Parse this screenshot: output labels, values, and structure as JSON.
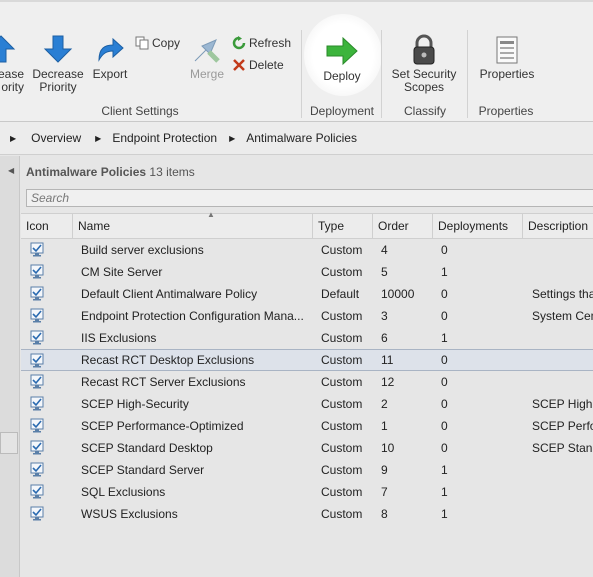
{
  "ribbon": {
    "decrease_priority_partial": [
      "ease",
      "ority"
    ],
    "decrease_priority": [
      "Decrease",
      "Priority"
    ],
    "export": "Export",
    "copy": "Copy",
    "merge": "Merge",
    "refresh": "Refresh",
    "delete": "Delete",
    "deploy": "Deploy",
    "set_security_scopes": [
      "Set Security",
      "Scopes"
    ],
    "properties": "Properties",
    "groups": {
      "client_settings": "Client Settings",
      "deployment": "Deployment",
      "classify": "Classify",
      "properties": "Properties"
    }
  },
  "breadcrumb": [
    "Overview",
    "Endpoint Protection",
    "Antimalware Policies"
  ],
  "list": {
    "title": "Antimalware Policies",
    "count": "13 items",
    "search_placeholder": "Search",
    "columns": [
      "Icon",
      "Name",
      "Type",
      "Order",
      "Deployments",
      "Description"
    ],
    "rows": [
      {
        "name": "Build server exclusions",
        "type": "Custom",
        "order": "4",
        "deployments": "0",
        "description": ""
      },
      {
        "name": "CM Site Server",
        "type": "Custom",
        "order": "5",
        "deployments": "1",
        "description": ""
      },
      {
        "name": "Default Client Antimalware Policy",
        "type": "Default",
        "order": "10000",
        "deployments": "0",
        "description": "Settings tha"
      },
      {
        "name": "Endpoint Protection Configuration Mana...",
        "type": "Custom",
        "order": "3",
        "deployments": "0",
        "description": "System Cen"
      },
      {
        "name": "IIS Exclusions",
        "type": "Custom",
        "order": "6",
        "deployments": "1",
        "description": ""
      },
      {
        "name": "Recast RCT Desktop Exclusions",
        "type": "Custom",
        "order": "11",
        "deployments": "0",
        "description": ""
      },
      {
        "name": "Recast RCT Server Exclusions",
        "type": "Custom",
        "order": "12",
        "deployments": "0",
        "description": ""
      },
      {
        "name": "SCEP High-Security",
        "type": "Custom",
        "order": "2",
        "deployments": "0",
        "description": "SCEP High-"
      },
      {
        "name": "SCEP Performance-Optimized",
        "type": "Custom",
        "order": "1",
        "deployments": "0",
        "description": "SCEP Perfor"
      },
      {
        "name": "SCEP Standard Desktop",
        "type": "Custom",
        "order": "10",
        "deployments": "0",
        "description": "SCEP Standa"
      },
      {
        "name": "SCEP Standard Server",
        "type": "Custom",
        "order": "9",
        "deployments": "1",
        "description": ""
      },
      {
        "name": "SQL Exclusions",
        "type": "Custom",
        "order": "7",
        "deployments": "1",
        "description": ""
      },
      {
        "name": "WSUS Exclusions",
        "type": "Custom",
        "order": "8",
        "deployments": "1",
        "description": ""
      }
    ],
    "selected_row": "Recast RCT Desktop Exclusions"
  },
  "colors": {
    "deploy_arrow": "#3cb43c",
    "priority_arrow": "#2a7fd4",
    "selected_row": "#dde2ea"
  },
  "icons": {
    "row": "policy-check-icon",
    "deploy": "deploy-arrow-icon",
    "security": "padlock-icon",
    "properties": "properties-sheet-icon"
  }
}
